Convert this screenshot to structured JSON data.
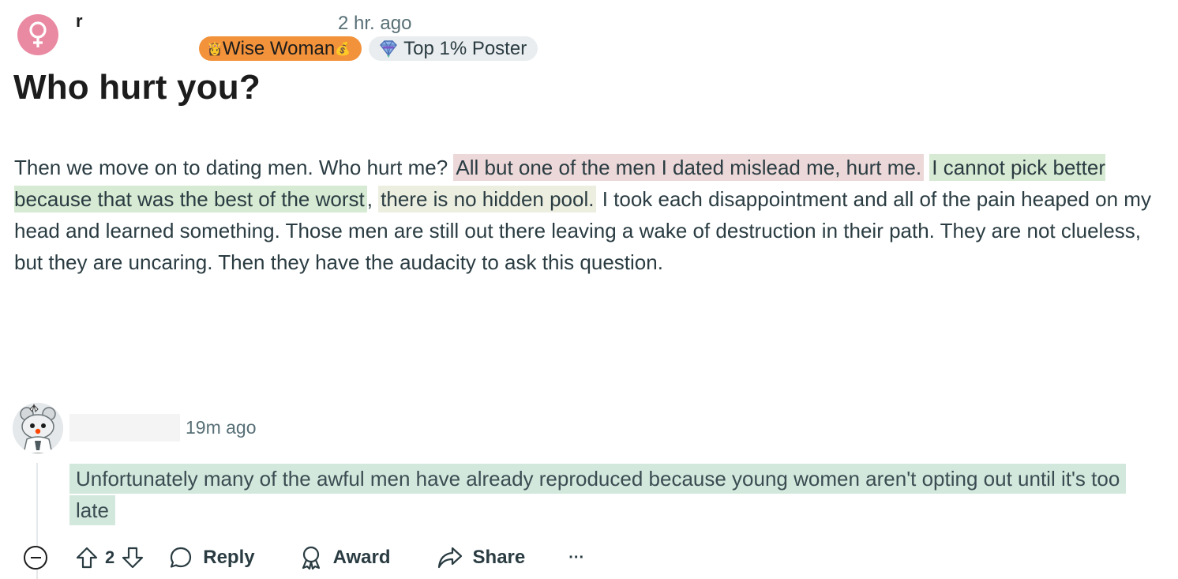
{
  "post": {
    "username": "r",
    "time": "2 hr. ago",
    "flairs": {
      "wise": "Wise Woman",
      "wise_emoji_left": "👸",
      "wise_emoji_right": "💰",
      "top": "Top 1% Poster",
      "top_icon": "diamond-badge-icon"
    },
    "title": "Who hurt you?",
    "body": {
      "p1": "Then we move on to dating men. Who hurt me? ",
      "hl1": "All but one of the men I dated mislead me, hurt me.",
      "hl2": "I cannot pick better because that was the best of the worst",
      "comma": ", ",
      "hl3": "there is no hidden pool.",
      "p2": " I took each disappointment and all of the pain heaped on my head and learned something. Those men are still out there leaving a wake of destruction in their path. They are not clueless, but they are uncaring. Then they have the audacity to ask this question."
    },
    "colors": {
      "avatar": "#ea8aa2",
      "flair_wise": "#f2923a",
      "flair_top": "#eaedef",
      "highlight_red": "#ecd8d8",
      "highlight_green": "#d7ead3",
      "highlight_yellow": "#eceee0",
      "highlight_teal": "#d3e8dc"
    }
  },
  "comment": {
    "time": "19m ago",
    "text": "Unfortunately many of the awful men have already reproduced because young women aren't opting out until it's too late",
    "actions": {
      "vote_count": "2",
      "reply": "Reply",
      "award": "Award",
      "share": "Share",
      "more": "···"
    }
  }
}
